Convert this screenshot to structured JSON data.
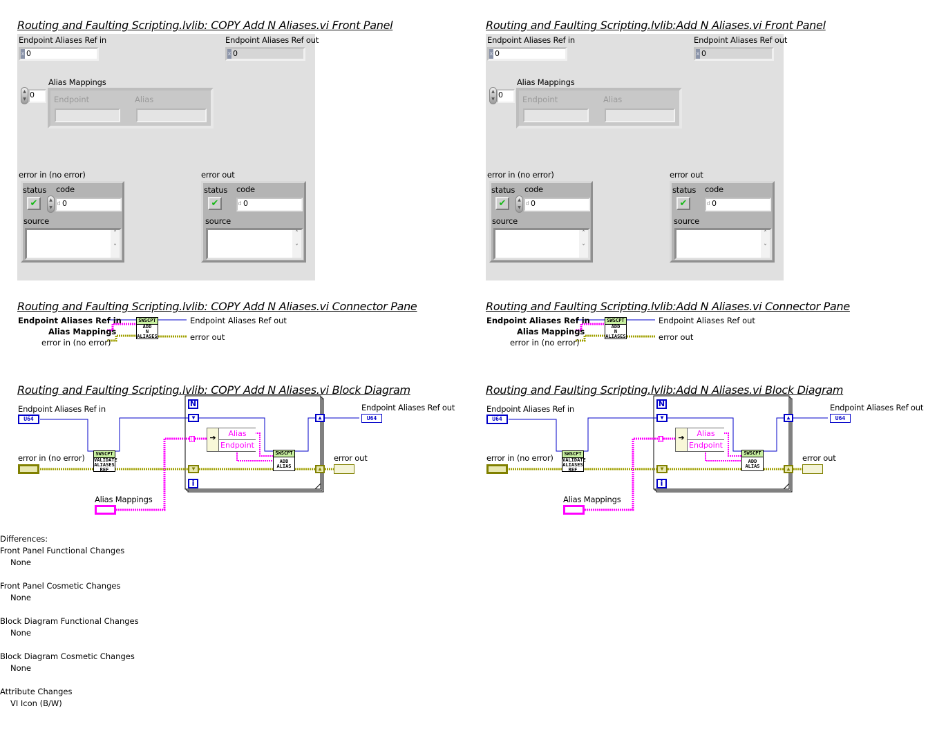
{
  "left": {
    "front_panel_title": "Routing and Faulting Scripting.lvlib:  COPY  Add N Aliases.vi Front Panel",
    "connector_pane_title": "Routing and Faulting Scripting.lvlib:  COPY  Add N Aliases.vi Connector Pane",
    "block_diagram_title": "Routing and Faulting Scripting.lvlib:  COPY  Add N Aliases.vi Block Diagram"
  },
  "right": {
    "front_panel_title": "Routing and Faulting Scripting.lvlib:Add N Aliases.vi Front Panel",
    "connector_pane_title": "Routing and Faulting Scripting.lvlib:Add N Aliases.vi Connector Pane",
    "block_diagram_title": "Routing and Faulting Scripting.lvlib:Add N Aliases.vi Block Diagram"
  },
  "front_panel": {
    "ref_in_label": "Endpoint Aliases Ref in",
    "ref_in_value": "0",
    "ref_out_label": "Endpoint Aliases Ref out",
    "ref_out_value": "0",
    "radix": "x",
    "alias_mappings_label": "Alias Mappings",
    "array_index": "0",
    "col_endpoint": "Endpoint",
    "col_alias": "Alias",
    "error_in_label": "error in (no error)",
    "error_out_label": "error out",
    "status_label": "status",
    "code_label": "code",
    "code_radix": "d",
    "code_value": "0",
    "source_label": "source",
    "status_glyph": "✔"
  },
  "connector_pane": {
    "in_ref": "Endpoint Aliases Ref in",
    "in_alias": "Alias Mappings",
    "in_error": "error in (no error)",
    "out_ref": "Endpoint Aliases Ref out",
    "out_error": "error out",
    "icon_header": "SWSCPT",
    "icon_body": [
      "ADD",
      "N",
      "ALIASES"
    ]
  },
  "block_diagram": {
    "ref_in_label": "Endpoint Aliases Ref in",
    "error_in_label": "error in (no error)",
    "alias_mappings_label": "Alias Mappings",
    "ref_out_label": "Endpoint Aliases Ref out",
    "error_out_label": "error out",
    "u64": "U64",
    "loop_count": "N",
    "loop_index": "i",
    "validate_header": "SWSCPT",
    "validate_body": [
      "VALIDATE",
      "ALIASES",
      "REF"
    ],
    "add_header": "SWSCPT",
    "add_body": [
      "ADD",
      "ALIAS"
    ],
    "unbundle_alias": "Alias",
    "unbundle_endpoint": "Endpoint"
  },
  "differences": {
    "heading": "Differences:",
    "sections": [
      {
        "title": "Front Panel Functional Changes",
        "detail": "None"
      },
      {
        "title": "Front Panel Cosmetic Changes",
        "detail": "None"
      },
      {
        "title": "Block Diagram Functional Changes",
        "detail": "None"
      },
      {
        "title": "Block Diagram Cosmetic Changes",
        "detail": "None"
      },
      {
        "title": "Attribute Changes",
        "detail": "VI Icon (B/W)"
      }
    ]
  },
  "colors": {
    "refnum_wire": "#0000c8",
    "cluster_pink": "#ff00ff",
    "error_wire": "#a0a000",
    "panel_bg": "#e0e0e0"
  }
}
